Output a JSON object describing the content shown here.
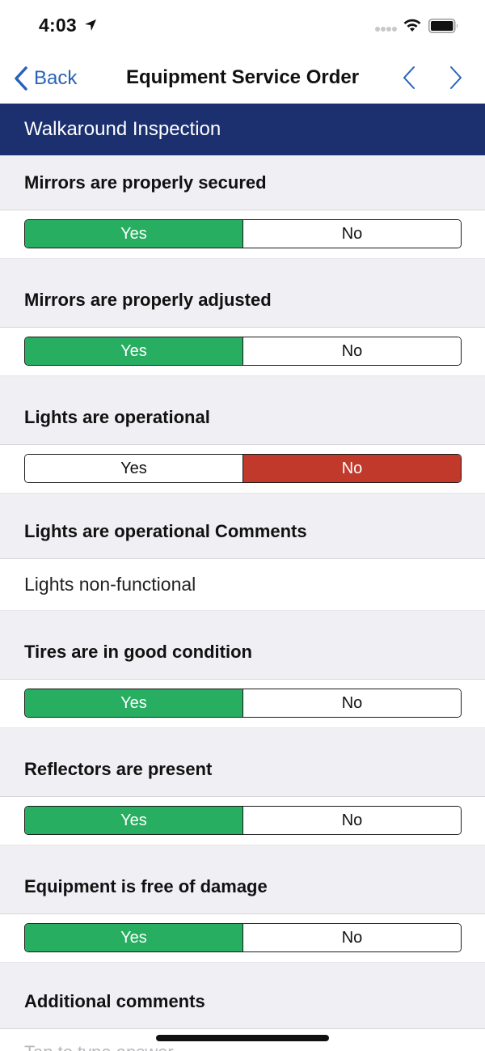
{
  "status_bar": {
    "time": "4:03"
  },
  "nav": {
    "back_label": "Back",
    "title": "Equipment Service Order"
  },
  "section": {
    "title": "Walkaround Inspection"
  },
  "questions": [
    {
      "label": "Mirrors are properly secured",
      "yes": "Yes",
      "no": "No",
      "selected": "Yes"
    },
    {
      "label": "Mirrors are properly adjusted",
      "yes": "Yes",
      "no": "No",
      "selected": "Yes"
    },
    {
      "label": "Lights are operational",
      "yes": "Yes",
      "no": "No",
      "selected": "No"
    },
    {
      "label": "Lights are operational Comments",
      "value": "Lights non-functional"
    },
    {
      "label": "Tires are in good condition",
      "yes": "Yes",
      "no": "No",
      "selected": "Yes"
    },
    {
      "label": "Reflectors are present",
      "yes": "Yes",
      "no": "No",
      "selected": "Yes"
    },
    {
      "label": "Equipment is free of damage",
      "yes": "Yes",
      "no": "No",
      "selected": "Yes"
    },
    {
      "label": "Additional comments",
      "placeholder": "Tap to type answer"
    }
  ],
  "colors": {
    "section_bg": "#1c2f6e",
    "yes_selected": "#27ae60",
    "no_selected": "#c0392b",
    "link": "#2962b8"
  }
}
